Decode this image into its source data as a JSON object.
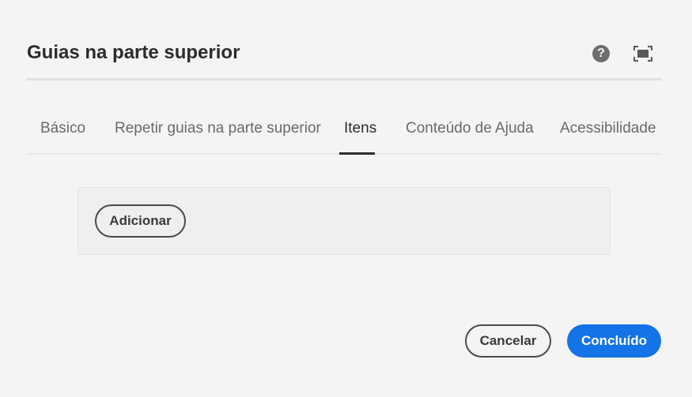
{
  "dialog": {
    "title": "Guias na parte superior",
    "help_icon": "help-circle-icon",
    "help_glyph": "?",
    "fullscreen_icon": "fullscreen-icon"
  },
  "tabs": [
    {
      "label": "Básico",
      "active": false
    },
    {
      "label": "Repetir guias na parte superior",
      "active": false
    },
    {
      "label": "Itens",
      "active": true
    },
    {
      "label": "Conteúdo de Ajuda",
      "active": false
    },
    {
      "label": "Acessibilidade",
      "active": false
    }
  ],
  "items_panel": {
    "add_label": "Adicionar"
  },
  "footer": {
    "cancel_label": "Cancelar",
    "done_label": "Concluído"
  },
  "colors": {
    "background": "#f4f4f4",
    "primary": "#1473e6",
    "text": "#2c2c2c"
  }
}
